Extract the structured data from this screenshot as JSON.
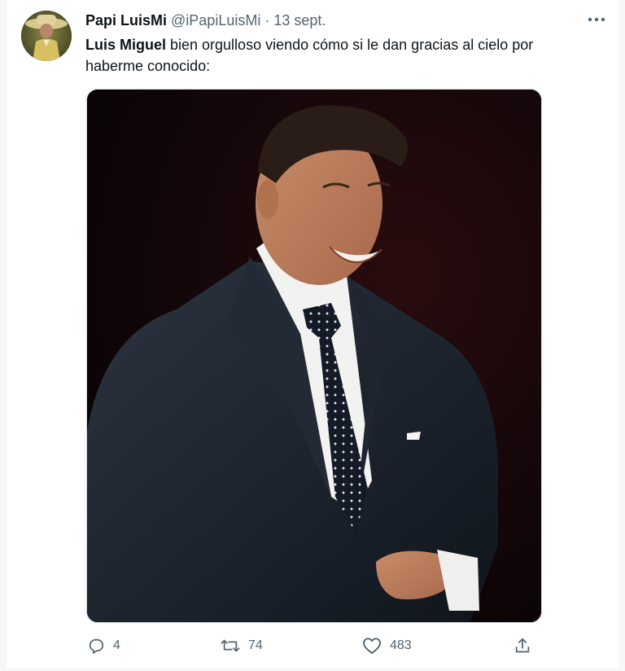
{
  "tweet": {
    "display_name": "Papi LuisMi",
    "handle": "@iPapiLuisMi",
    "separator": "·",
    "date": "13 sept.",
    "text_bold": "Luis Miguel",
    "text_rest": " bien orgulloso viendo cómo si le dan gracias al cielo por haberme conocido:",
    "media_alt": "",
    "actions": {
      "reply_count": "4",
      "retweet_count": "74",
      "like_count": "483"
    }
  },
  "icons": {
    "more": "more-horizontal-icon",
    "reply": "reply-icon",
    "retweet": "retweet-icon",
    "like": "heart-icon",
    "share": "share-icon"
  },
  "colors": {
    "text_primary": "#0f1419",
    "text_secondary": "#536471",
    "border": "#cfd9de"
  }
}
